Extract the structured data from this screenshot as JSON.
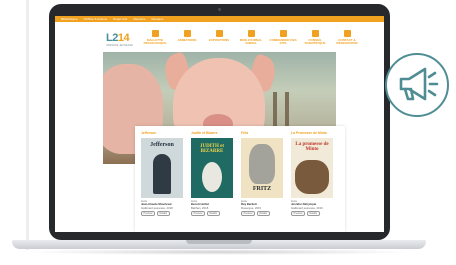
{
  "site": {
    "topbar_links": [
      "Bibliothèque",
      "Chiffres & Actions",
      "Projet club",
      "Mentions",
      "Réseaux"
    ],
    "logo": {
      "main_a": "L2",
      "main_b": "14",
      "sub": "LIBRAIRIE JEUNESSE"
    },
    "nav": [
      {
        "icon": "suitcase-icon",
        "label": "MALLETTE PÉDAGOGIQUE"
      },
      {
        "icon": "book-icon",
        "label": "ANIMATIONS"
      },
      {
        "icon": "easel-icon",
        "label": "EXPOSITIONS"
      },
      {
        "icon": "newspaper-icon",
        "label": "MON JOURNAL ANIMAL"
      },
      {
        "icon": "basket-icon",
        "label": "COMMANDER DES KITS"
      },
      {
        "icon": "flask-icon",
        "label": "CONSEIL SCIENTIFIQUE"
      },
      {
        "icon": "phone-icon",
        "label": "CONTACT & RÉSERVATION"
      }
    ],
    "books": [
      {
        "title": "Jefferson",
        "cover_text": "Jefferson",
        "type": "Livre",
        "author": "Jean-Claude Mourlevat",
        "publisher": "Gallimard jeunesse, 2018",
        "btn_preview": "Preview",
        "btn_detail": "Détails"
      },
      {
        "title": "Judith et Bizarre",
        "cover_text": "JUDITH et BIZARRE",
        "type": "Livre",
        "author": "Benoît Hollist",
        "publisher": "Balthan, 2018",
        "btn_preview": "Preview",
        "btn_detail": "Détails"
      },
      {
        "title": "Fritz",
        "cover_text": "FRITZ",
        "type": "Livre",
        "author": "Ray Bartlett",
        "publisher": "Rouergue, 2015",
        "btn_preview": "Preview",
        "btn_detail": "Détails"
      },
      {
        "title": "La Promesse de Minto",
        "cover_text": "La promesse de Minto",
        "type": "Livre",
        "author": "Jennifer Dalrymple",
        "publisher": "Gallimard jeunesse, 2016",
        "btn_preview": "Preview",
        "btn_detail": "Détails"
      }
    ]
  },
  "colors": {
    "accent": "#f0a11f",
    "teal": "#4f8d95",
    "laptop": "#26282b"
  },
  "badge_icon": "megaphone-icon"
}
